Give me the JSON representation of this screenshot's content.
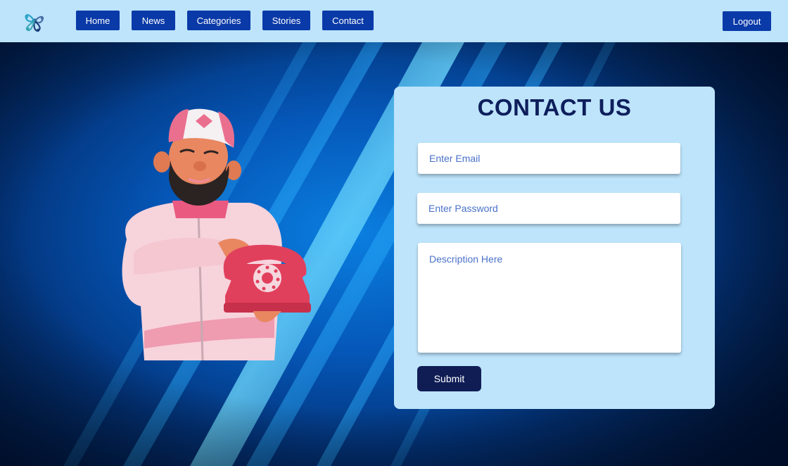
{
  "nav": {
    "logo_icon": "molecule-logo-icon",
    "items": [
      {
        "label": "Home"
      },
      {
        "label": "News"
      },
      {
        "label": "Categories"
      },
      {
        "label": "Stories"
      },
      {
        "label": "Contact"
      }
    ],
    "logout_label": "Logout"
  },
  "contact": {
    "title": "CONTACT US",
    "email_placeholder": "Enter Email",
    "password_placeholder": "Enter Password",
    "description_placeholder": "Description Here",
    "submit_label": "Submit"
  },
  "illustration": {
    "icon": "man-with-telephone-illustration"
  },
  "colors": {
    "navbar_bg": "#bde4fb",
    "nav_button": "#0a3aa8",
    "card_bg": "#bde4fb",
    "title": "#0e1e5b",
    "submit_bg": "#101d55",
    "placeholder": "#4a72c9"
  }
}
